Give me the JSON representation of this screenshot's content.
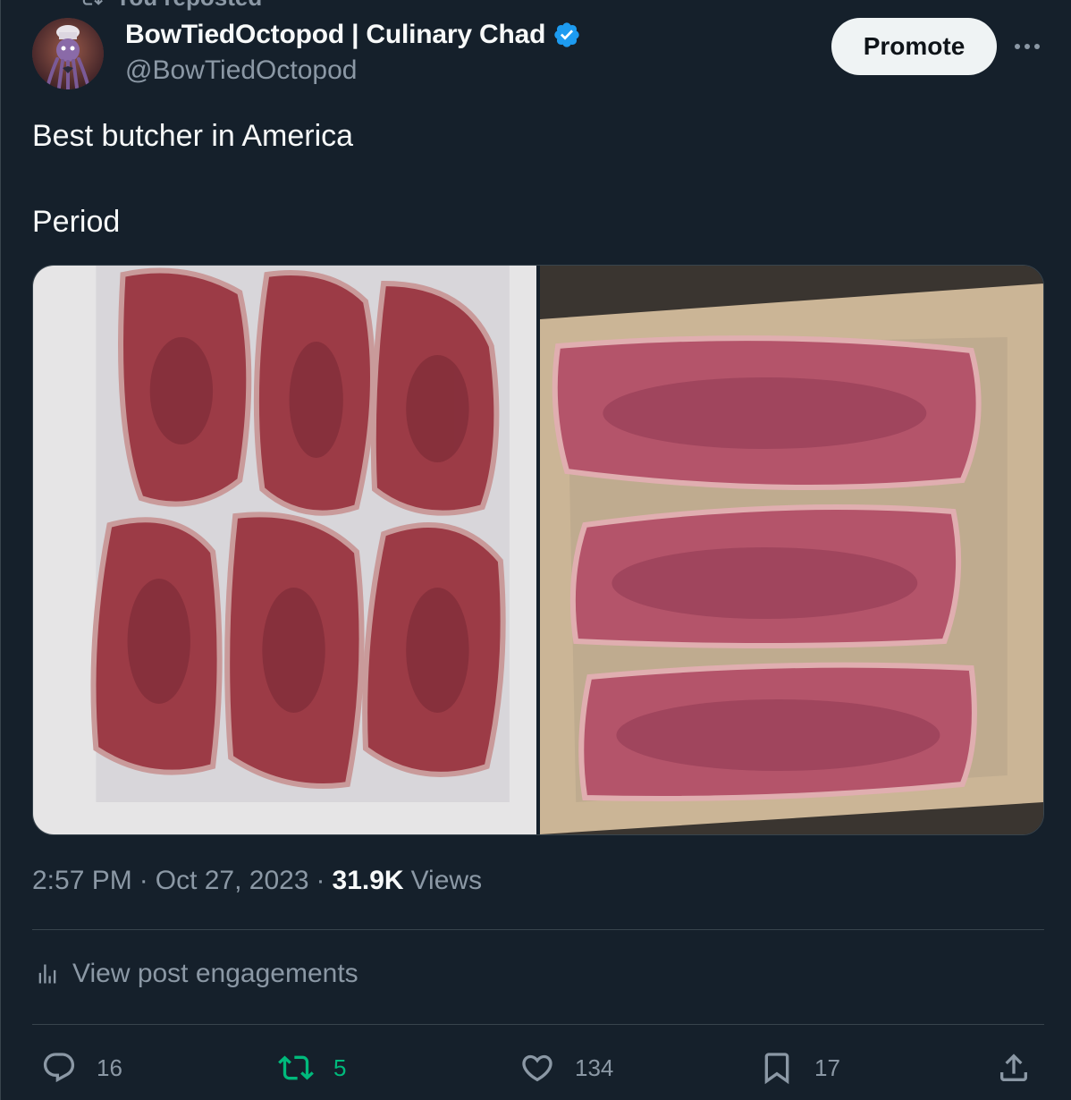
{
  "reposted_label": "You reposted",
  "author": {
    "display_name": "BowTiedOctopod | Culinary Chad",
    "handle": "@BowTiedOctopod",
    "verified": true
  },
  "promote_label": "Promote",
  "post": {
    "lines": [
      "Best butcher in America",
      "Period"
    ]
  },
  "media": [
    {
      "icon": "ribeye-steaks-photo"
    },
    {
      "icon": "strip-steaks-photo"
    }
  ],
  "meta": {
    "time": "2:57 PM",
    "separator1": "·",
    "date": "Oct 27, 2023",
    "separator2": "·",
    "views_count": "31.9K",
    "views_label": "Views"
  },
  "engagements_label": "View post engagements",
  "actions": {
    "replies": "16",
    "reposts": "5",
    "likes": "134",
    "bookmarks": "17"
  },
  "colors": {
    "background": "#15202b",
    "border": "#38444d",
    "text_secondary": "#8b98a5",
    "verified_blue": "#1d9bf0",
    "repost_green": "#00ba7c"
  }
}
